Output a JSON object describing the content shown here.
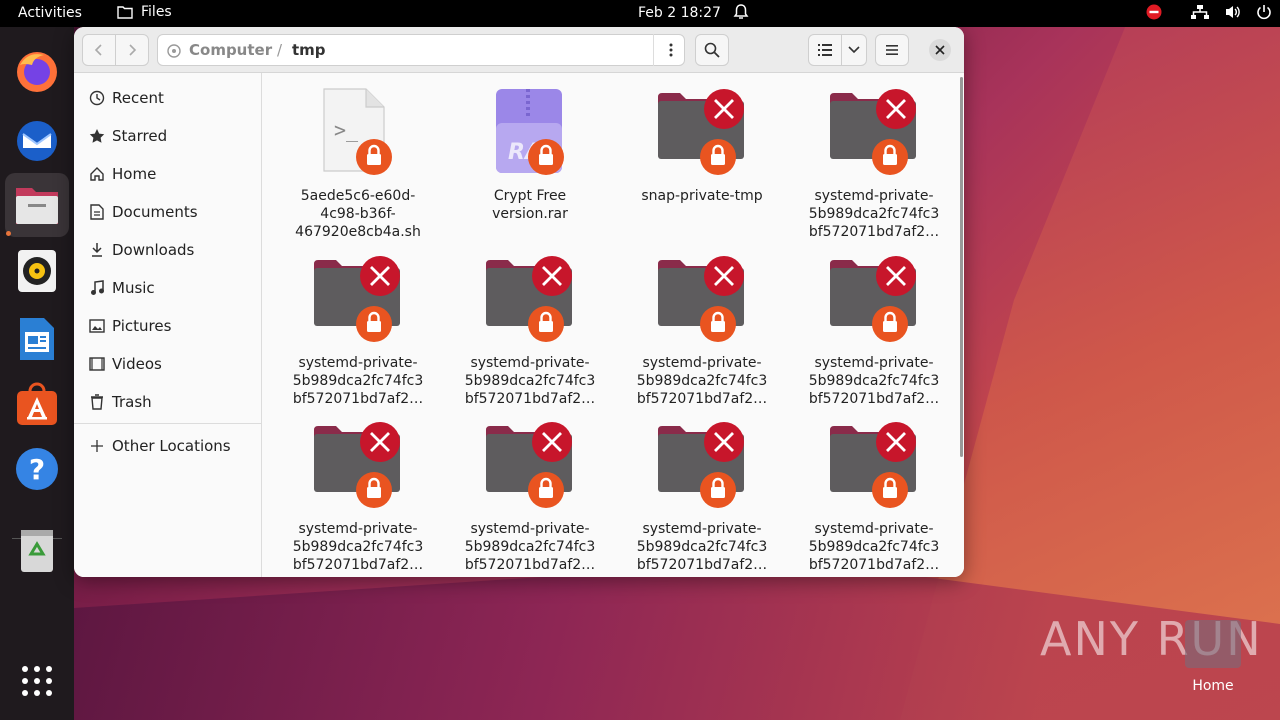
{
  "topbar": {
    "activities": "Activities",
    "app_name": "Files",
    "clock": "Feb 2  18:27"
  },
  "dock": {
    "items": [
      "firefox-icon",
      "thunderbird-icon",
      "files-icon",
      "rhythmbox-icon",
      "writer-icon",
      "app-center-icon",
      "help-icon",
      "trash-icon",
      "show-apps-icon"
    ]
  },
  "window": {
    "path": {
      "root": "Computer",
      "separator": "/",
      "current": "tmp"
    },
    "sidebar": {
      "items": [
        {
          "label": "Recent",
          "icon": "clock-icon"
        },
        {
          "label": "Starred",
          "icon": "star-icon"
        },
        {
          "label": "Home",
          "icon": "home-icon"
        },
        {
          "label": "Documents",
          "icon": "document-icon"
        },
        {
          "label": "Downloads",
          "icon": "download-icon"
        },
        {
          "label": "Music",
          "icon": "music-icon"
        },
        {
          "label": "Pictures",
          "icon": "picture-icon"
        },
        {
          "label": "Videos",
          "icon": "video-icon"
        },
        {
          "label": "Trash",
          "icon": "trash-icon"
        }
      ],
      "other": {
        "label": "Other Locations",
        "icon": "plus-icon"
      }
    },
    "files": [
      {
        "name": "5aede5c6-e60d-4c98-b36f-467920e8cb4a.sh",
        "lines": [
          "5aede5c6-e60d-",
          "4c98-b36f-",
          "467920e8cb4a.sh"
        ],
        "type": "script"
      },
      {
        "name": "Crypt Free version.rar",
        "lines": [
          "Crypt Free",
          "version.rar"
        ],
        "type": "rar"
      },
      {
        "name": "snap-private-tmp",
        "lines": [
          "snap-private-tmp"
        ],
        "type": "folder"
      },
      {
        "name": "systemd-private-5b989dca2fc74fc3bf572071bd7af2…",
        "lines": [
          "systemd-private-",
          "5b989dca2fc74fc3",
          "bf572071bd7af2…"
        ],
        "type": "folder"
      },
      {
        "name": "systemd-private-5b989dca2fc74fc3bf572071bd7af2…",
        "lines": [
          "systemd-private-",
          "5b989dca2fc74fc3",
          "bf572071bd7af2…"
        ],
        "type": "folder"
      },
      {
        "name": "systemd-private-5b989dca2fc74fc3bf572071bd7af2…",
        "lines": [
          "systemd-private-",
          "5b989dca2fc74fc3",
          "bf572071bd7af2…"
        ],
        "type": "folder"
      },
      {
        "name": "systemd-private-5b989dca2fc74fc3bf572071bd7af2…",
        "lines": [
          "systemd-private-",
          "5b989dca2fc74fc3",
          "bf572071bd7af2…"
        ],
        "type": "folder"
      },
      {
        "name": "systemd-private-5b989dca2fc74fc3bf572071bd7af2…",
        "lines": [
          "systemd-private-",
          "5b989dca2fc74fc3",
          "bf572071bd7af2…"
        ],
        "type": "folder"
      },
      {
        "name": "systemd-private-5b989dca2fc74fc3bf572071bd7af2…",
        "lines": [
          "systemd-private-",
          "5b989dca2fc74fc3",
          "bf572071bd7af2…"
        ],
        "type": "folder"
      },
      {
        "name": "systemd-private-5b989dca2fc74fc3bf572071bd7af2…",
        "lines": [
          "systemd-private-",
          "5b989dca2fc74fc3",
          "bf572071bd7af2…"
        ],
        "type": "folder"
      },
      {
        "name": "systemd-private-5b989dca2fc74fc3bf572071bd7af2…",
        "lines": [
          "systemd-private-",
          "5b989dca2fc74fc3",
          "bf572071bd7af2…"
        ],
        "type": "folder"
      },
      {
        "name": "systemd-private-5b989dca2fc74fc3bf572071bd7af2…",
        "lines": [
          "systemd-private-",
          "5b989dca2fc74fc3",
          "bf572071bd7af2…"
        ],
        "type": "folder"
      }
    ]
  },
  "desktop": {
    "home_label": "Home",
    "watermark": "ANY RUN"
  },
  "colors": {
    "accent": "#e95420",
    "error": "#c7162b",
    "folder": "#5e5c5e",
    "folder_tab": "#8a2b4a"
  }
}
